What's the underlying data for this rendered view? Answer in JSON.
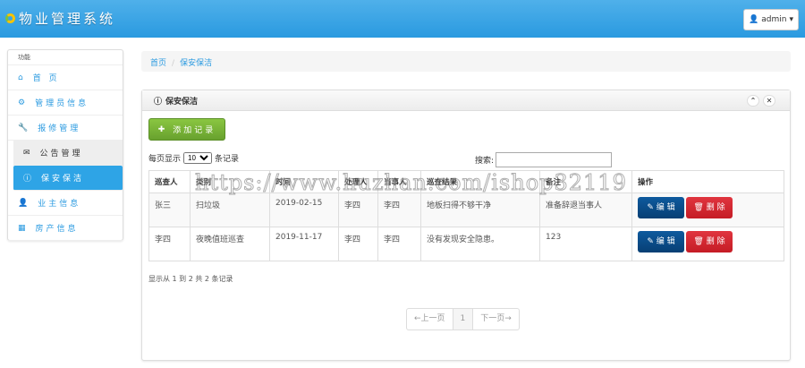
{
  "app": {
    "title": "物业管理系统",
    "user": "admin"
  },
  "sidebar": {
    "title": "功能",
    "items": [
      {
        "label": "首 页",
        "icon": "home-icon"
      },
      {
        "label": "管理员信息",
        "icon": "gear-icon"
      },
      {
        "label": "报修管理",
        "icon": "wrench-icon"
      },
      {
        "label": "公告管理",
        "icon": "envelope-icon"
      },
      {
        "label": "保安保洁",
        "icon": "info-icon"
      },
      {
        "label": "业主信息",
        "icon": "user-icon"
      },
      {
        "label": "房产信息",
        "icon": "calendar-icon"
      }
    ]
  },
  "breadcrumb": [
    "首页",
    "保安保洁"
  ],
  "panel": {
    "title": "保安保洁",
    "add_label": "添加记录",
    "length_prefix": "每页显示",
    "length_value": "10",
    "length_suffix": "条记录",
    "search_label": "搜索:",
    "search_value": ""
  },
  "table": {
    "headers": [
      "巡查人",
      "类别",
      "时间",
      "处理人",
      "当事人",
      "巡查结果",
      "备注",
      "操作"
    ],
    "rows": [
      [
        "张三",
        "扫垃圾",
        "2019-02-15",
        "李四",
        "李四",
        "地板扫得不够干净",
        "准备辞退当事人"
      ],
      [
        "李四",
        "夜晚值班巡查",
        "2019-11-17",
        "李四",
        "李四",
        "没有发现安全隐患。",
        "123"
      ]
    ],
    "edit_label": "编 辑",
    "delete_label": "删 除"
  },
  "info": "显示从 1 到 2 共 2 条记录",
  "pager": {
    "prev": "←上一页",
    "current": "1",
    "next": "下一页→"
  },
  "watermark": "https://www.huzhan.com/ishop32119"
}
